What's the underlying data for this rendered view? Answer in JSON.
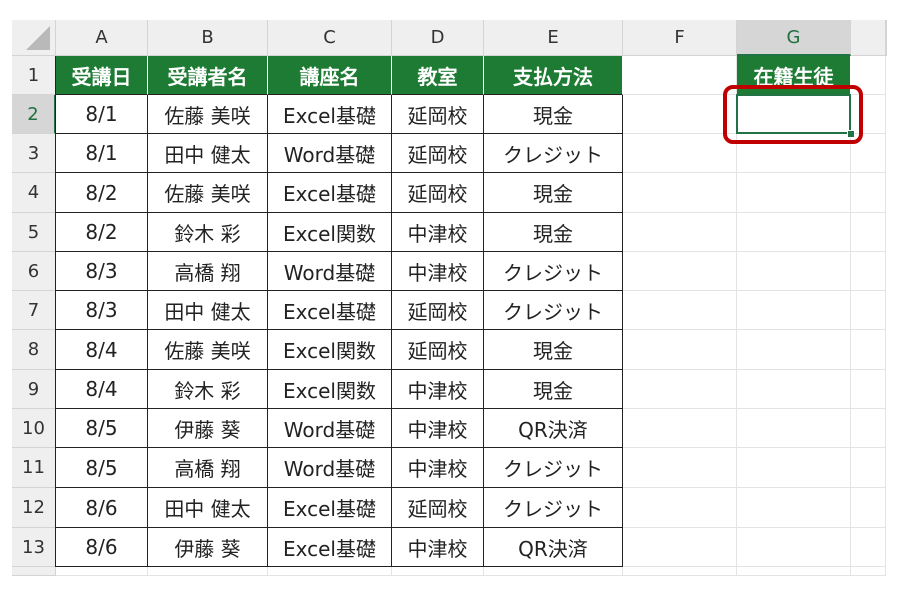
{
  "columns": [
    "A",
    "B",
    "C",
    "D",
    "E",
    "F",
    "G"
  ],
  "selected_column": "G",
  "selected_row": "2",
  "header_row_number": "1",
  "table_headers": [
    "受講日",
    "受講者名",
    "講座名",
    "教室",
    "支払方法"
  ],
  "rows": [
    {
      "num": "2",
      "cells": [
        "8/1",
        "佐藤 美咲",
        "Excel基礎",
        "延岡校",
        "現金"
      ]
    },
    {
      "num": "3",
      "cells": [
        "8/1",
        "田中 健太",
        "Word基礎",
        "延岡校",
        "クレジット"
      ]
    },
    {
      "num": "4",
      "cells": [
        "8/2",
        "佐藤 美咲",
        "Excel基礎",
        "延岡校",
        "現金"
      ]
    },
    {
      "num": "5",
      "cells": [
        "8/2",
        "鈴木 彩",
        "Excel関数",
        "中津校",
        "現金"
      ]
    },
    {
      "num": "6",
      "cells": [
        "8/3",
        "高橋 翔",
        "Word基礎",
        "中津校",
        "クレジット"
      ]
    },
    {
      "num": "7",
      "cells": [
        "8/3",
        "田中 健太",
        "Excel基礎",
        "延岡校",
        "クレジット"
      ]
    },
    {
      "num": "8",
      "cells": [
        "8/4",
        "佐藤 美咲",
        "Excel関数",
        "延岡校",
        "現金"
      ]
    },
    {
      "num": "9",
      "cells": [
        "8/4",
        "鈴木 彩",
        "Excel関数",
        "中津校",
        "現金"
      ]
    },
    {
      "num": "10",
      "cells": [
        "8/5",
        "伊藤 葵",
        "Word基礎",
        "中津校",
        "QR決済"
      ]
    },
    {
      "num": "11",
      "cells": [
        "8/5",
        "高橋 翔",
        "Word基礎",
        "中津校",
        "クレジット"
      ]
    },
    {
      "num": "12",
      "cells": [
        "8/6",
        "田中 健太",
        "Excel基礎",
        "延岡校",
        "クレジット"
      ]
    },
    {
      "num": "13",
      "cells": [
        "8/6",
        "伊藤 葵",
        "Excel基礎",
        "中津校",
        "QR決済"
      ]
    }
  ],
  "g_header": "在籍生徒",
  "active_cell_value": "",
  "colors": {
    "header_green": "#1e7b34",
    "selection_green": "#217346",
    "highlight_red": "#c00000"
  }
}
